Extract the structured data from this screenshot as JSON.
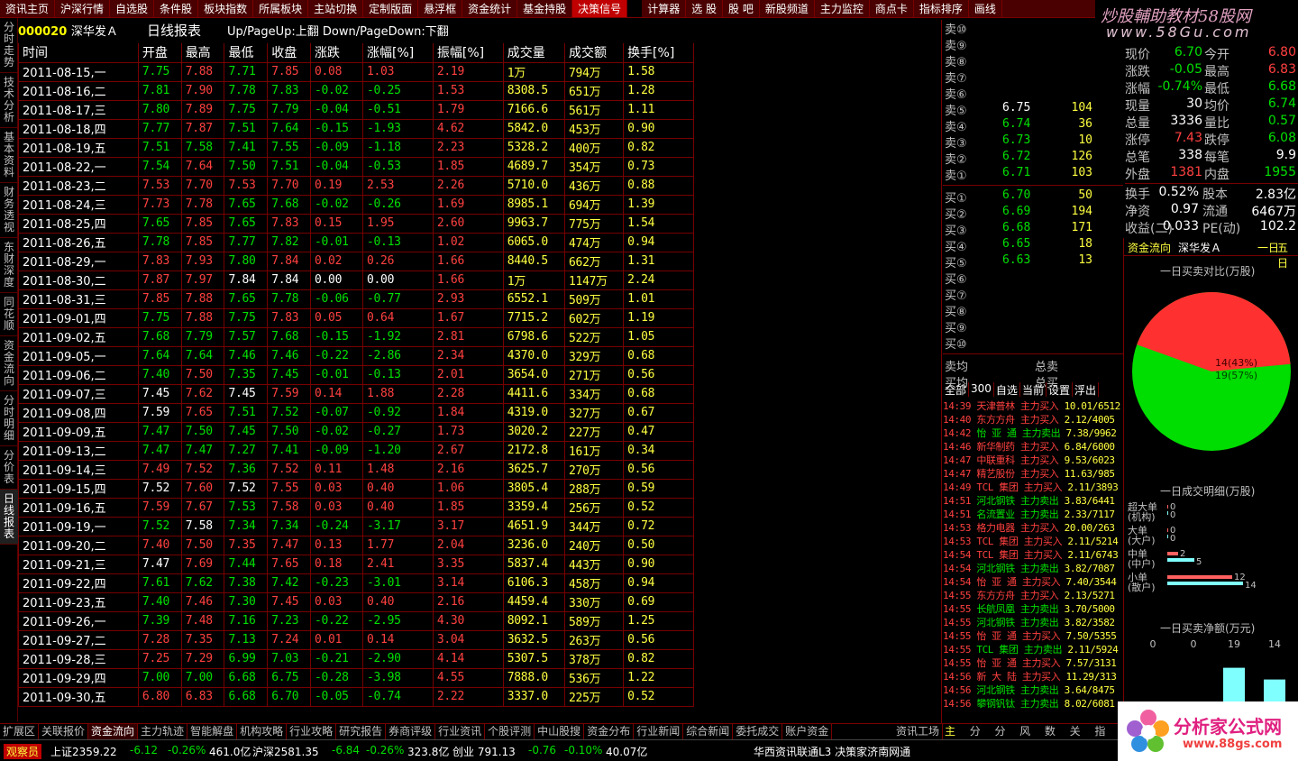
{
  "topnav": [
    "资讯主页",
    "沪深行情",
    "自选股",
    "条件股",
    "板块指数",
    "所属板块",
    "主站切换",
    "定制版面",
    "悬浮框",
    "资金统计",
    "基金持股",
    "决策信号",
    "",
    "计算器",
    "选 股",
    "股 吧",
    "新股频道",
    "主力监控",
    "商点卡",
    "指标排序",
    "画线"
  ],
  "topnav_active": 11,
  "watermark": {
    "line1": "炒股輔助教材58股网",
    "line2": "www.58Gu.com"
  },
  "lefttabs": [
    "分时走势",
    "技术分析",
    "基本资料",
    "财务透视",
    "东财深度",
    "同花顺",
    "资金流向",
    "分时明细",
    "分价表",
    "日线报表"
  ],
  "lefttab_active": 9,
  "header": {
    "code": "000020",
    "name": "深华发Ａ",
    "title": "日线报表",
    "hint": "Up/PageUp:上翻 Down/PageDown:下翻"
  },
  "columns": [
    "时间",
    "开盘",
    "最高",
    "最低",
    "收盘",
    "涨跌",
    "涨幅[%]",
    "振幅[%]",
    "成交量",
    "成交额",
    "换手[%]"
  ],
  "rows": [
    [
      "2011-08-15,一",
      "7.75",
      "7.88",
      "7.71",
      "7.85",
      "0.08",
      "1.03",
      "2.19",
      "1万",
      "794万",
      "1.58"
    ],
    [
      "2011-08-16,二",
      "7.81",
      "7.90",
      "7.78",
      "7.83",
      "-0.02",
      "-0.25",
      "1.53",
      "8308.5",
      "651万",
      "1.28"
    ],
    [
      "2011-08-17,三",
      "7.80",
      "7.89",
      "7.75",
      "7.79",
      "-0.04",
      "-0.51",
      "1.79",
      "7166.6",
      "561万",
      "1.11"
    ],
    [
      "2011-08-18,四",
      "7.77",
      "7.87",
      "7.51",
      "7.64",
      "-0.15",
      "-1.93",
      "4.62",
      "5842.0",
      "453万",
      "0.90"
    ],
    [
      "2011-08-19,五",
      "7.51",
      "7.58",
      "7.41",
      "7.55",
      "-0.09",
      "-1.18",
      "2.23",
      "5328.2",
      "400万",
      "0.82"
    ],
    [
      "2011-08-22,一",
      "7.54",
      "7.64",
      "7.50",
      "7.51",
      "-0.04",
      "-0.53",
      "1.85",
      "4689.7",
      "354万",
      "0.73"
    ],
    [
      "2011-08-23,二",
      "7.53",
      "7.70",
      "7.53",
      "7.70",
      "0.19",
      "2.53",
      "2.26",
      "5710.0",
      "436万",
      "0.88"
    ],
    [
      "2011-08-24,三",
      "7.73",
      "7.78",
      "7.65",
      "7.68",
      "-0.02",
      "-0.26",
      "1.69",
      "8985.1",
      "694万",
      "1.39"
    ],
    [
      "2011-08-25,四",
      "7.65",
      "7.85",
      "7.65",
      "7.83",
      "0.15",
      "1.95",
      "2.60",
      "9963.7",
      "775万",
      "1.54"
    ],
    [
      "2011-08-26,五",
      "7.78",
      "7.85",
      "7.77",
      "7.82",
      "-0.01",
      "-0.13",
      "1.02",
      "6065.0",
      "474万",
      "0.94"
    ],
    [
      "2011-08-29,一",
      "7.83",
      "7.93",
      "7.80",
      "7.84",
      "0.02",
      "0.26",
      "1.66",
      "8440.5",
      "662万",
      "1.31"
    ],
    [
      "2011-08-30,二",
      "7.87",
      "7.97",
      "7.84",
      "7.84",
      "0.00",
      "0.00",
      "1.66",
      "1万",
      "1147万",
      "2.24"
    ],
    [
      "2011-08-31,三",
      "7.85",
      "7.88",
      "7.65",
      "7.78",
      "-0.06",
      "-0.77",
      "2.93",
      "6552.1",
      "509万",
      "1.01"
    ],
    [
      "2011-09-01,四",
      "7.75",
      "7.88",
      "7.75",
      "7.83",
      "0.05",
      "0.64",
      "1.67",
      "7715.2",
      "602万",
      "1.19"
    ],
    [
      "2011-09-02,五",
      "7.68",
      "7.79",
      "7.57",
      "7.68",
      "-0.15",
      "-1.92",
      "2.81",
      "6798.6",
      "522万",
      "1.05"
    ],
    [
      "2011-09-05,一",
      "7.64",
      "7.64",
      "7.46",
      "7.46",
      "-0.22",
      "-2.86",
      "2.34",
      "4370.0",
      "329万",
      "0.68"
    ],
    [
      "2011-09-06,二",
      "7.40",
      "7.50",
      "7.35",
      "7.45",
      "-0.01",
      "-0.13",
      "2.01",
      "3654.0",
      "271万",
      "0.56"
    ],
    [
      "2011-09-07,三",
      "7.45",
      "7.62",
      "7.45",
      "7.59",
      "0.14",
      "1.88",
      "2.28",
      "4411.6",
      "334万",
      "0.68"
    ],
    [
      "2011-09-08,四",
      "7.59",
      "7.65",
      "7.51",
      "7.52",
      "-0.07",
      "-0.92",
      "1.84",
      "4319.0",
      "327万",
      "0.67"
    ],
    [
      "2011-09-09,五",
      "7.47",
      "7.50",
      "7.45",
      "7.50",
      "-0.02",
      "-0.27",
      "1.73",
      "3020.2",
      "227万",
      "0.47"
    ],
    [
      "2011-09-13,二",
      "7.47",
      "7.47",
      "7.27",
      "7.41",
      "-0.09",
      "-1.20",
      "2.67",
      "2172.8",
      "161万",
      "0.34"
    ],
    [
      "2011-09-14,三",
      "7.49",
      "7.52",
      "7.36",
      "7.52",
      "0.11",
      "1.48",
      "2.16",
      "3625.7",
      "270万",
      "0.56"
    ],
    [
      "2011-09-15,四",
      "7.52",
      "7.60",
      "7.52",
      "7.55",
      "0.03",
      "0.40",
      "1.06",
      "3805.4",
      "288万",
      "0.59"
    ],
    [
      "2011-09-16,五",
      "7.59",
      "7.67",
      "7.53",
      "7.58",
      "0.03",
      "0.40",
      "1.85",
      "3359.4",
      "256万",
      "0.52"
    ],
    [
      "2011-09-19,一",
      "7.52",
      "7.58",
      "7.34",
      "7.34",
      "-0.24",
      "-3.17",
      "3.17",
      "4651.9",
      "344万",
      "0.72"
    ],
    [
      "2011-09-20,二",
      "7.40",
      "7.50",
      "7.35",
      "7.47",
      "0.13",
      "1.77",
      "2.04",
      "3236.0",
      "240万",
      "0.50"
    ],
    [
      "2011-09-21,三",
      "7.47",
      "7.69",
      "7.44",
      "7.65",
      "0.18",
      "2.41",
      "3.35",
      "5837.4",
      "443万",
      "0.90"
    ],
    [
      "2011-09-22,四",
      "7.61",
      "7.62",
      "7.38",
      "7.42",
      "-0.23",
      "-3.01",
      "3.14",
      "6106.3",
      "458万",
      "0.94"
    ],
    [
      "2011-09-23,五",
      "7.40",
      "7.46",
      "7.30",
      "7.45",
      "0.03",
      "0.40",
      "2.16",
      "4459.4",
      "330万",
      "0.69"
    ],
    [
      "2011-09-26,一",
      "7.39",
      "7.48",
      "7.16",
      "7.23",
      "-0.22",
      "-2.95",
      "4.30",
      "8092.1",
      "589万",
      "1.25"
    ],
    [
      "2011-09-27,二",
      "7.28",
      "7.35",
      "7.13",
      "7.24",
      "0.01",
      "0.14",
      "3.04",
      "3632.5",
      "263万",
      "0.56"
    ],
    [
      "2011-09-28,三",
      "7.25",
      "7.29",
      "6.99",
      "7.03",
      "-0.21",
      "-2.90",
      "4.14",
      "5307.5",
      "378万",
      "0.82"
    ],
    [
      "2011-09-29,四",
      "7.00",
      "7.00",
      "6.68",
      "6.75",
      "-0.28",
      "-3.98",
      "4.55",
      "7888.0",
      "536万",
      "1.22"
    ],
    [
      "2011-09-30,五",
      "6.80",
      "6.83",
      "6.68",
      "6.70",
      "-0.05",
      "-0.74",
      "2.22",
      "3337.0",
      "225万",
      "0.52"
    ]
  ],
  "orderbook": {
    "asks": [
      {
        "label": "卖⑩",
        "price": "",
        "vol": ""
      },
      {
        "label": "卖⑨",
        "price": "",
        "vol": ""
      },
      {
        "label": "卖⑧",
        "price": "",
        "vol": ""
      },
      {
        "label": "卖⑦",
        "price": "",
        "vol": ""
      },
      {
        "label": "卖⑥",
        "price": "",
        "vol": ""
      },
      {
        "label": "卖⑤",
        "price": "6.75",
        "vol": "104"
      },
      {
        "label": "卖④",
        "price": "6.74",
        "vol": "36"
      },
      {
        "label": "卖③",
        "price": "6.73",
        "vol": "10"
      },
      {
        "label": "卖②",
        "price": "6.72",
        "vol": "126"
      },
      {
        "label": "卖①",
        "price": "6.71",
        "vol": "103"
      }
    ],
    "bids": [
      {
        "label": "买①",
        "price": "6.70",
        "vol": "50"
      },
      {
        "label": "买②",
        "price": "6.69",
        "vol": "194"
      },
      {
        "label": "买③",
        "price": "6.68",
        "vol": "171"
      },
      {
        "label": "买④",
        "price": "6.65",
        "vol": "18"
      },
      {
        "label": "买⑤",
        "price": "6.63",
        "vol": "13"
      },
      {
        "label": "买⑥",
        "price": "",
        "vol": ""
      },
      {
        "label": "买⑦",
        "price": "",
        "vol": ""
      },
      {
        "label": "买⑧",
        "price": "",
        "vol": ""
      },
      {
        "label": "买⑨",
        "price": "",
        "vol": ""
      },
      {
        "label": "买⑩",
        "price": "",
        "vol": ""
      }
    ],
    "sell_avg": "卖均",
    "buy_avg": "买均",
    "total_sell": "总卖",
    "total_buy": "总买"
  },
  "stats": [
    {
      "l1": "现价",
      "v1": "6.70",
      "l2": "今开",
      "v2": "6.80",
      "c1": "dn",
      "c2": "up"
    },
    {
      "l1": "涨跌",
      "v1": "-0.05",
      "l2": "最高",
      "v2": "6.83",
      "c1": "dn",
      "c2": "up"
    },
    {
      "l1": "涨幅",
      "v1": "-0.74%",
      "l2": "最低",
      "v2": "6.68",
      "c1": "dn",
      "c2": "dn"
    },
    {
      "l1": "现量",
      "v1": "30",
      "l2": "均价",
      "v2": "6.74",
      "c1": "eq",
      "c2": "dn"
    },
    {
      "l1": "总量",
      "v1": "3336",
      "l2": "量比",
      "v2": "0.57",
      "c1": "eq",
      "c2": "dn"
    },
    {
      "l1": "涨停",
      "v1": "7.43",
      "l2": "跌停",
      "v2": "6.08",
      "c1": "up",
      "c2": "dn"
    },
    {
      "l1": "总笔",
      "v1": "338",
      "l2": "每笔",
      "v2": "9.9",
      "c1": "eq",
      "c2": "eq"
    },
    {
      "l1": "外盘",
      "v1": "1381",
      "l2": "内盘",
      "v2": "1955",
      "c1": "up",
      "c2": "dn"
    }
  ],
  "stats2": [
    {
      "l1": "换手",
      "v1": "0.52%",
      "l2": "股本",
      "v2": "2.83亿"
    },
    {
      "l1": "净资",
      "v1": "0.97",
      "l2": "流通",
      "v2": "6467万"
    },
    {
      "l1": "收益(二)",
      "v1": "0.033",
      "l2": "PE(动)",
      "v2": "102.2"
    }
  ],
  "ticktabs": [
    "全部",
    "300",
    "自选",
    "当前",
    "设置",
    "浮出"
  ],
  "ticks": [
    {
      "t": "14:39",
      "s": "天津普林",
      "a": "主力买入",
      "p": "10.01/6512",
      "buy": true
    },
    {
      "t": "14:40",
      "s": "东方方舟",
      "a": "主力买入",
      "p": "2.12/4005",
      "buy": true
    },
    {
      "t": "14:42",
      "s": "怡 亚 通",
      "a": "主力卖出",
      "p": "7.38/9962",
      "buy": false
    },
    {
      "t": "14:46",
      "s": "新华制药",
      "a": "主力买入",
      "p": "6.84/6000",
      "buy": true
    },
    {
      "t": "14:47",
      "s": "中联重科",
      "a": "主力买入",
      "p": "9.53/6023",
      "buy": true
    },
    {
      "t": "14:47",
      "s": "精艺股份",
      "a": "主力买入",
      "p": "11.63/985",
      "buy": true
    },
    {
      "t": "14:49",
      "s": "TCL 集团",
      "a": "主力买入",
      "p": "2.11/3893",
      "buy": true
    },
    {
      "t": "14:51",
      "s": "河北钢铁",
      "a": "主力卖出",
      "p": "3.83/6441",
      "buy": false
    },
    {
      "t": "14:51",
      "s": "名流置业",
      "a": "主力卖出",
      "p": "2.33/7117",
      "buy": false
    },
    {
      "t": "14:53",
      "s": "格力电器",
      "a": "主力买入",
      "p": "20.00/263",
      "buy": true
    },
    {
      "t": "14:53",
      "s": "TCL 集团",
      "a": "主力买入",
      "p": "2.11/5214",
      "buy": true
    },
    {
      "t": "14:54",
      "s": "TCL 集团",
      "a": "主力买入",
      "p": "2.11/6743",
      "buy": true
    },
    {
      "t": "14:54",
      "s": "河北钢铁",
      "a": "主力卖出",
      "p": "3.82/7087",
      "buy": false
    },
    {
      "t": "14:54",
      "s": "怡 亚 通",
      "a": "主力买入",
      "p": "7.40/3544",
      "buy": true
    },
    {
      "t": "14:55",
      "s": "东方方舟",
      "a": "主力买入",
      "p": "2.13/5271",
      "buy": true
    },
    {
      "t": "14:55",
      "s": "长航凤凰",
      "a": "主力卖出",
      "p": "3.70/5000",
      "buy": false
    },
    {
      "t": "14:55",
      "s": "河北钢铁",
      "a": "主力卖出",
      "p": "3.82/3582",
      "buy": false
    },
    {
      "t": "14:55",
      "s": "怡 亚 通",
      "a": "主力买入",
      "p": "7.50/5355",
      "buy": true
    },
    {
      "t": "14:55",
      "s": "TCL 集团",
      "a": "主力卖出",
      "p": "2.11/5924",
      "buy": false
    },
    {
      "t": "14:55",
      "s": "怡 亚 通",
      "a": "主力买入",
      "p": "7.57/3131",
      "buy": true
    },
    {
      "t": "14:56",
      "s": "新 大 陆",
      "a": "主力买入",
      "p": "11.29/313",
      "buy": true
    },
    {
      "t": "14:56",
      "s": "河北钢铁",
      "a": "主力卖出",
      "p": "3.64/8475",
      "buy": false
    },
    {
      "t": "14:56",
      "s": "攀钢钒钛",
      "a": "主力卖出",
      "p": "8.02/6081",
      "buy": false
    }
  ],
  "fund": {
    "tab": "资金流向",
    "stock": "深华发Ａ",
    "d1": "一日",
    "d5": "五日",
    "pie_title": "一日买卖对比(万股)",
    "pie": {
      "buy_label": "14(43%)",
      "sell_label": "19(57%)",
      "buy_pct": 43,
      "buy_color": "#ff3030",
      "sell_color": "#00dd00"
    },
    "detail_title": "一日成交明细(万股)",
    "detail": [
      {
        "name": "超大单",
        "name2": "(机构)",
        "buy": 0,
        "sell": 0
      },
      {
        "name": "大单",
        "name2": "(大户)",
        "buy": 0,
        "sell": 0
      },
      {
        "name": "中单",
        "name2": "(中户)",
        "buy": 2,
        "sell": 5
      },
      {
        "name": "小单",
        "name2": "(散户)",
        "buy": 12,
        "sell": 14
      }
    ],
    "net_title": "一日买卖净额(万元)",
    "net_labels": [
      "0",
      "0",
      "19",
      "14"
    ],
    "net_cats": [
      "超大单",
      "大单",
      "中单",
      "小单"
    ]
  },
  "bottomtabs": [
    "扩展区",
    "关联报价",
    "资金流向",
    "主力轨迹",
    "智能解盘",
    "机构攻略",
    "行业攻略",
    "研究报告",
    "券商评级",
    "行业资讯",
    "个股评测",
    "中山股搜",
    "资金分布",
    "行业新闻",
    "综合新闻",
    "委托成交",
    "账户资金",
    "",
    "资讯工场"
  ],
  "bottomtab_active": 2,
  "rbt": [
    "主力",
    "分笔",
    "分价",
    "风向",
    "数值",
    "关联",
    "指标"
  ],
  "status": {
    "observer": "观察员",
    "sh": "上证2359.22",
    "sh_chg": "-6.12",
    "sh_pct": "-0.26%",
    "sh_amt": "461.0亿",
    "hs": "沪深2581.35",
    "hs_chg": "-6.84",
    "hs_pct": "-0.26%",
    "hs_amt": "323.8亿",
    "cy": "创业 791.13",
    "cy_chg": "-0.76",
    "cy_pct": "-0.10%",
    "cy_amt": "40.07亿",
    "server": "华西资讯联通L3 决策家济南网通"
  },
  "logo": {
    "text": "分析家公式网",
    "url": "www.88gs.com"
  }
}
